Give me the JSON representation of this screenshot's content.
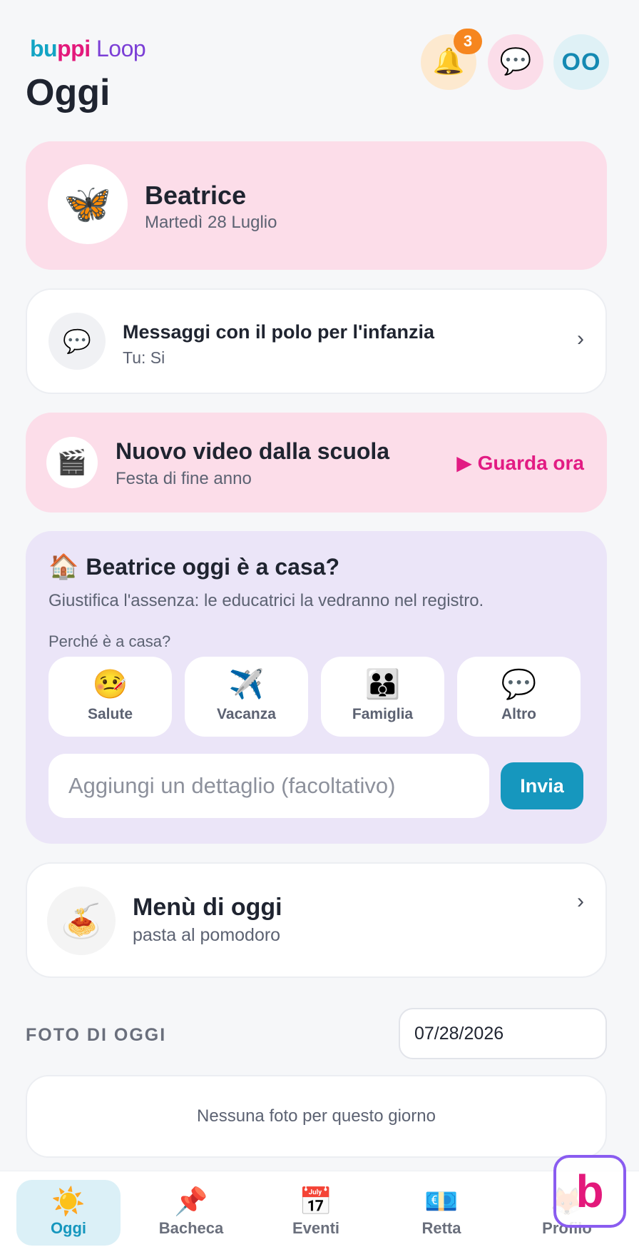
{
  "header": {
    "logo_part1": "bu",
    "logo_part2": "ppi",
    "logo_part3": " Loop",
    "title": "Oggi",
    "notifications_count": "3",
    "bell_icon": "🔔",
    "chat_icon": "💬",
    "avatar_initials": "OO"
  },
  "child": {
    "name": "Beatrice",
    "date": "Martedì 28 Luglio",
    "avatar_icon": "🦋"
  },
  "messages_card": {
    "icon": "💬",
    "title": "Messaggi con il polo per l'infanzia",
    "subtitle": "Tu: Si",
    "chevron": "›"
  },
  "video_card": {
    "icon": "🎬",
    "title": "Nuovo video dalla scuola",
    "subtitle": "Festa di fine anno",
    "action": "▶ Guarda ora"
  },
  "absence_card": {
    "icon": "🏠",
    "title": "Beatrice oggi è a casa?",
    "subtitle": "Giustifica l'assenza: le educatrici la vedranno nel registro.",
    "question": "Perché è a casa?",
    "reasons": [
      {
        "icon": "🤒",
        "label": "Salute"
      },
      {
        "icon": "✈️",
        "label": "Vacanza"
      },
      {
        "icon": "👪",
        "label": "Famiglia"
      },
      {
        "icon": "💬",
        "label": "Altro"
      }
    ],
    "detail_placeholder": "Aggiungi un dettaglio (facoltativo)",
    "send_label": "Invia"
  },
  "menu_card": {
    "icon": "🍝",
    "title": "Menù di oggi",
    "subtitle": "pasta al pomodoro",
    "chevron": "›"
  },
  "photos": {
    "section_label": "FOTO DI OGGI",
    "date_value": "07/28/2026",
    "empty_text": "Nessuna foto per questo giorno"
  },
  "bottom_nav": [
    {
      "icon": "☀️",
      "label": "Oggi",
      "active": true
    },
    {
      "icon": "📌",
      "label": "Bacheca",
      "active": false
    },
    {
      "icon": "📅",
      "label": "Eventi",
      "active": false
    },
    {
      "icon": "💶",
      "label": "Retta",
      "active": false
    },
    {
      "icon": "🦊",
      "label": "Profilo",
      "active": false
    }
  ],
  "brand_badge": "b",
  "colors": {
    "accent": "#1697be",
    "pink_card": "#fcdde9",
    "lavender_card": "#ebe5f8",
    "badge": "#f6861f",
    "link_pink": "#e21b83"
  }
}
